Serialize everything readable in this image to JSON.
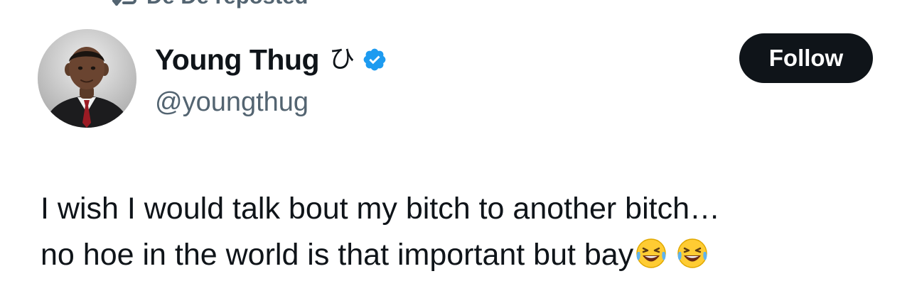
{
  "repost": {
    "label": "De De reposted",
    "icon": "repost-icon"
  },
  "author": {
    "display_name": "Young Thug",
    "name_glyph": "ひ",
    "handle": "@youngthug",
    "verified": true,
    "verified_color": "#1d9bf0",
    "avatar": "avatar-photo"
  },
  "follow_button": {
    "label": "Follow",
    "background": "#0f1419",
    "text_color": "#ffffff"
  },
  "tweet": {
    "lines": [
      "I wish I would talk bout my bitch to another bitch…",
      "no hoe in the world is that important but bay"
    ],
    "emojis": [
      "😂",
      "😂"
    ]
  },
  "colors": {
    "text": "#0f1419",
    "secondary_text": "#536471"
  }
}
